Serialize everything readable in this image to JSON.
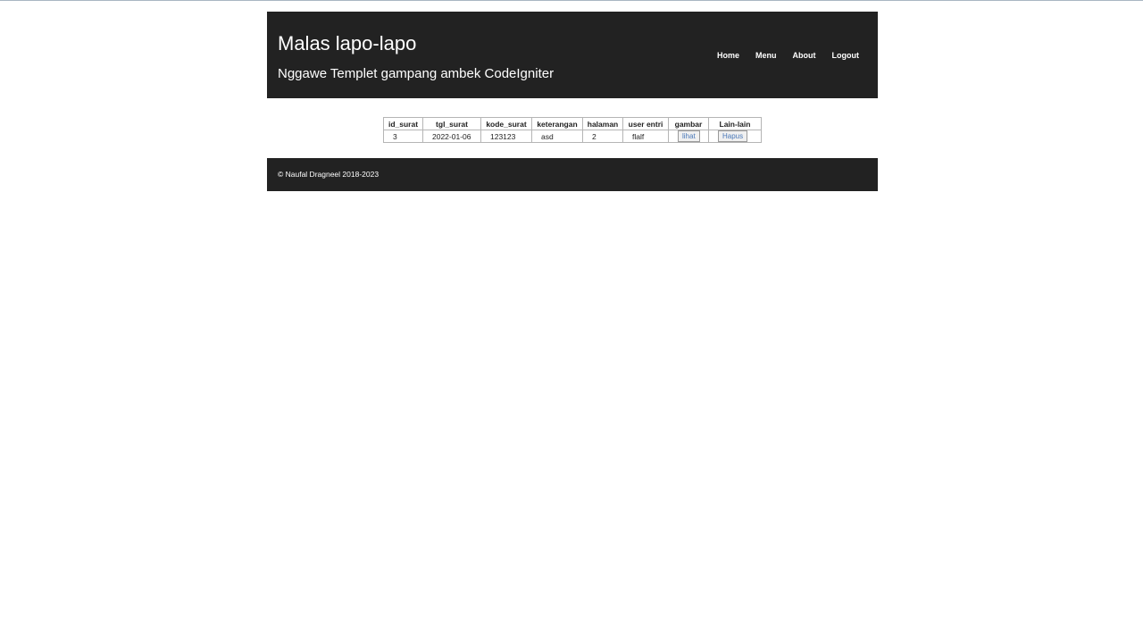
{
  "header": {
    "title": "Malas lapo-lapo",
    "subtitle": "Nggawe Templet gampang ambek CodeIgniter",
    "nav": [
      "Home",
      "Menu",
      "About",
      "Logout"
    ]
  },
  "table": {
    "columns": [
      "id_surat",
      "tgl_surat",
      "kode_surat",
      "keterangan",
      "halaman",
      "user entri",
      "gambar",
      "Lain-lain"
    ],
    "rows": [
      {
        "id_surat": "3",
        "tgl_surat": "2022-01-06",
        "kode_surat": "123123",
        "keterangan": "asd",
        "halaman": "2",
        "user_entri": "flalf",
        "gambar_button": "lihat",
        "lain_button": "Hapus"
      }
    ]
  },
  "footer": {
    "text": "© Naufal Dragneel 2018-2023"
  },
  "colors": {
    "header_bg": "#222222",
    "footer_bg": "#222222",
    "link": "#4a78b8"
  }
}
